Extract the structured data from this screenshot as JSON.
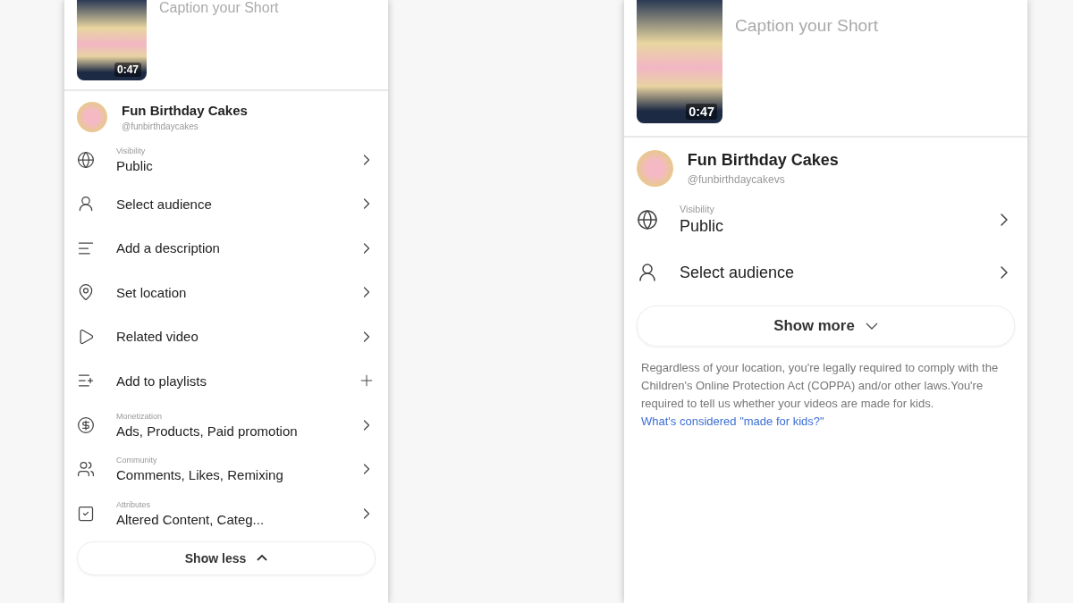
{
  "phones": [
    {
      "caption": {
        "placeholder": "Caption your Short"
      },
      "thumbnail": {
        "duration": "0:47"
      },
      "account": {
        "name": "Fun Birthday Cakes",
        "handle": "@funbirthdaycakes"
      },
      "settings": [
        {
          "kind": "link",
          "label": "Visibility",
          "value": "Public"
        },
        {
          "kind": "link",
          "value": "Select audience"
        },
        {
          "kind": "link",
          "value": "Add a description"
        },
        {
          "kind": "link",
          "value": "Set location"
        },
        {
          "kind": "link",
          "value": "Related video"
        },
        {
          "kind": "add",
          "value": "Add to playlists"
        },
        {
          "kind": "link",
          "label": "Monetization",
          "value": "Ads, Products, Paid promotion"
        },
        {
          "kind": "link",
          "label": "Community",
          "value": "Comments, Likes, Remixing"
        },
        {
          "kind": "link",
          "label": "Attributes",
          "value": "Altered Content, Categ..."
        }
      ],
      "toggle": {
        "label": "Show less",
        "expanded": true
      }
    },
    {
      "caption": {
        "placeholder": "Caption your Short"
      },
      "thumbnail": {
        "duration": "0:47"
      },
      "account": {
        "name": "Fun Birthday Cakes",
        "handle": "@funbirthdaycakevs"
      },
      "settings": [
        {
          "kind": "link",
          "label": "Visibility",
          "value": "Public"
        },
        {
          "kind": "link",
          "value": "Select audience"
        }
      ],
      "toggle": {
        "label": "Show more",
        "expanded": false
      },
      "notice": {
        "text": "Regardless of your location, you're legally required to comply with the Children's Online Protection Act (COPPA) and/or other laws.You're required to tell us whether your videos are made for kids.",
        "link": "What's considered \"made for kids?\""
      }
    }
  ]
}
